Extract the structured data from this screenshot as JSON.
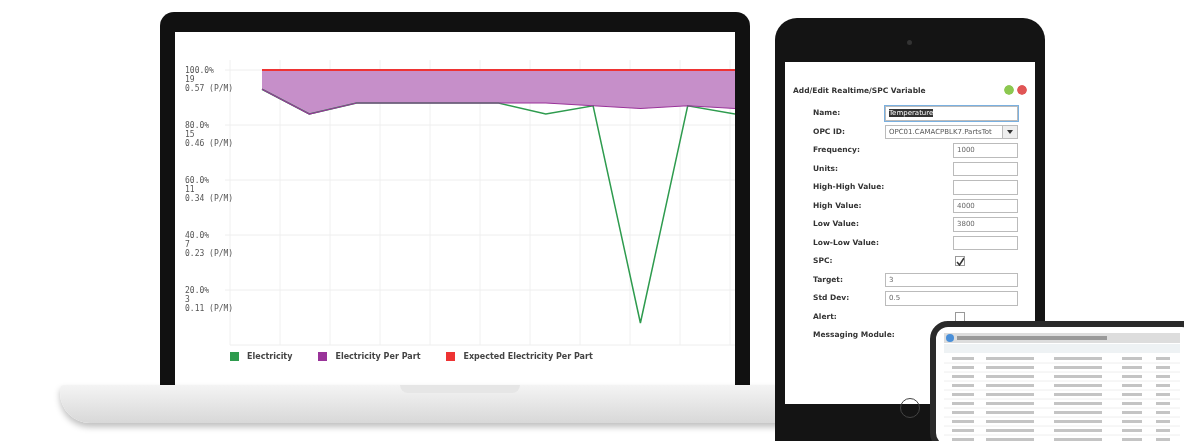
{
  "laptop": {
    "tick_sublabels": [
      {
        "line_2": "19",
        "line_3": "0.57 (P/M)"
      },
      {
        "line_2": "15",
        "line_3": "0.46 (P/M)"
      },
      {
        "line_2": "11",
        "line_3": "0.34 (P/M)"
      },
      {
        "line_2": "7",
        "line_3": "0.23 (P/M)"
      },
      {
        "line_2": "3",
        "line_3": "0.11 (P/M)"
      }
    ],
    "chart_data": {
      "type": "line",
      "categories": [
        null,
        null,
        null,
        null,
        null,
        null,
        null,
        null,
        null,
        null,
        null
      ],
      "ylim": [
        0,
        100
      ],
      "grid": true,
      "yticks": [
        {
          "value": 100,
          "label": "100.0%"
        },
        {
          "value": 80,
          "label": "80.0%"
        },
        {
          "value": 60,
          "label": "60.0%"
        },
        {
          "value": 40,
          "label": "40.0%"
        },
        {
          "value": 20,
          "label": "20.0%"
        }
      ],
      "series": [
        {
          "name": "Electricity",
          "color": "#2e9b4e",
          "values": [
            93,
            84,
            88,
            88,
            88,
            88,
            84,
            87,
            8,
            87,
            84
          ]
        },
        {
          "name": "Electricity Per Part",
          "color": "#993399",
          "values": [
            93,
            84,
            88,
            88,
            88,
            88,
            88,
            87,
            86,
            87,
            86
          ]
        },
        {
          "name": "Expected Electricity Per Part",
          "color": "#ee3333",
          "values": [
            100,
            100,
            100,
            100,
            100,
            100,
            100,
            100,
            100,
            100,
            100
          ]
        }
      ]
    }
  },
  "tablet": {
    "title": "Add/Edit Realtime/SPC Variable",
    "fields": [
      {
        "label": "Name:",
        "kind": "wide",
        "value": "Temperature",
        "highlighted": true
      },
      {
        "label": "OPC ID:",
        "kind": "select",
        "value": "OPC01.CAMACPBLK7.PartsTot"
      },
      {
        "label": "Frequency:",
        "kind": "short",
        "value": "1000"
      },
      {
        "label": "Units:",
        "kind": "short"
      },
      {
        "label": "High-High Value:",
        "kind": "short"
      },
      {
        "label": "High Value:",
        "kind": "short",
        "value": "4000"
      },
      {
        "label": "Low Value:",
        "kind": "short",
        "value": "3800"
      },
      {
        "label": "Low-Low Value:",
        "kind": "short"
      },
      {
        "label": "SPC:",
        "kind": "checkbox",
        "checked": true
      },
      {
        "label": "Target:",
        "kind": "wide",
        "value": "3"
      },
      {
        "label": "Std Dev:",
        "kind": "wide",
        "value": "0.5"
      },
      {
        "label": "Alert:",
        "kind": "checkbox",
        "checked": false
      },
      {
        "label": "Messaging Module:",
        "kind": "none"
      }
    ]
  }
}
